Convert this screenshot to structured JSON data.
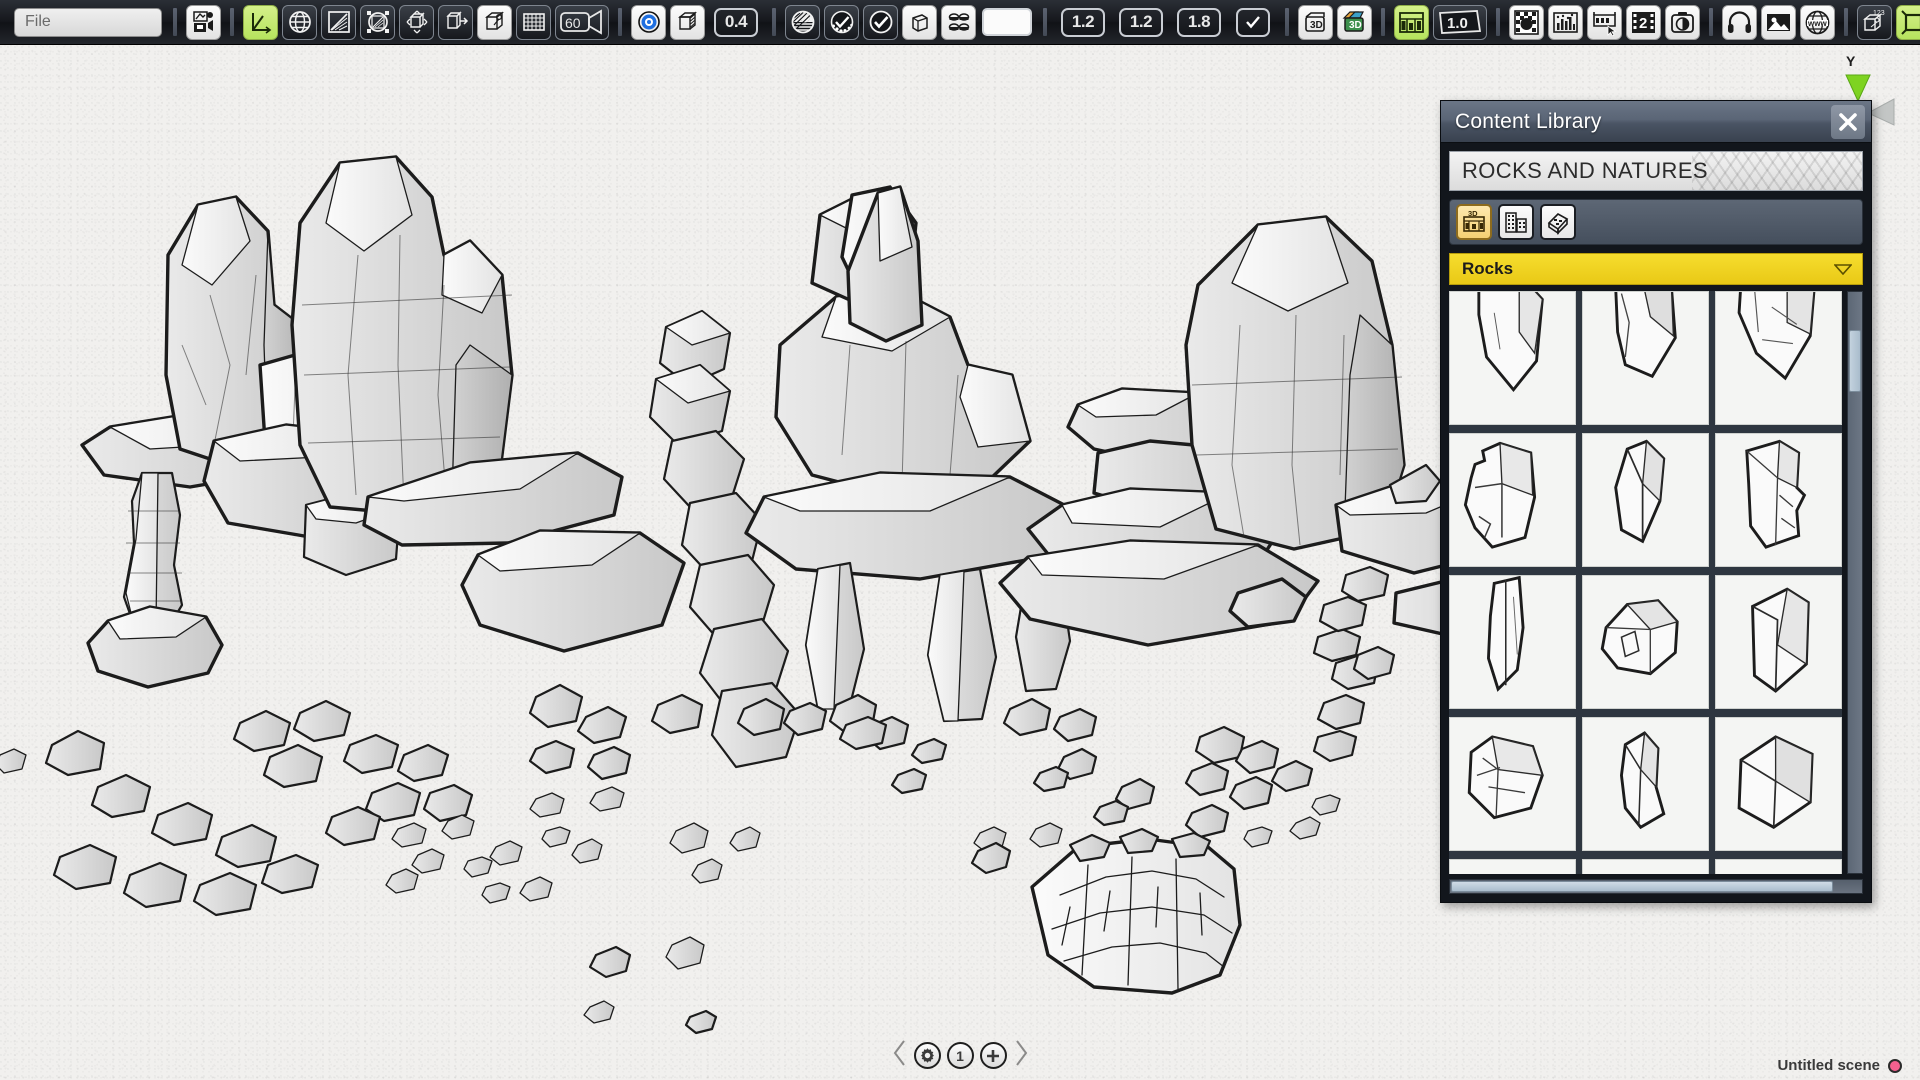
{
  "app": {
    "scene_name": "Untitled scene",
    "status_dot_color": "#f4608f"
  },
  "toolbar": {
    "file_menu_label": "File",
    "groups": [
      {
        "name": "file-group",
        "items": [
          {
            "id": "save-render-button",
            "icon": "save-render-icon",
            "style": "light",
            "label": ""
          }
        ]
      },
      {
        "name": "transform-group",
        "items": [
          {
            "id": "axis-tool-button",
            "icon": "axis-gizmo-icon",
            "style": "green",
            "label": ""
          },
          {
            "id": "globe-rotate-button",
            "icon": "globe-icon",
            "style": "dark",
            "label": ""
          },
          {
            "id": "gradient-plane-button",
            "icon": "gradient-square-icon",
            "style": "dark",
            "label": ""
          },
          {
            "id": "sphere-crop-button",
            "icon": "sphere-crop-icon",
            "style": "dark",
            "label": ""
          },
          {
            "id": "cube-rotate-button",
            "icon": "cube-rotate-icon",
            "style": "dark",
            "label": ""
          },
          {
            "id": "cube-move-button",
            "icon": "cube-move-icon",
            "style": "dark",
            "label": ""
          },
          {
            "id": "cube-point-button",
            "icon": "cube-point-icon",
            "style": "light",
            "label": ""
          },
          {
            "id": "grid-button",
            "icon": "grid-icon",
            "style": "dark",
            "label": ""
          },
          {
            "id": "camera-fov-button",
            "icon": "camera-icon",
            "style": "dark",
            "label": "60"
          }
        ]
      },
      {
        "name": "display-group",
        "items": [
          {
            "id": "target-button",
            "icon": "target-ring-icon",
            "style": "light",
            "label": ""
          },
          {
            "id": "cube-shade-button",
            "icon": "cube-hatched-icon",
            "style": "light",
            "label": ""
          },
          {
            "id": "opacity-field",
            "icon": "value-field",
            "style": "num",
            "label": "0.4"
          }
        ]
      },
      {
        "name": "shading-group",
        "items": [
          {
            "id": "shading-hatch-button",
            "icon": "sphere-hatch-icon",
            "style": "dark",
            "label": ""
          },
          {
            "id": "shading-dotted-button",
            "icon": "check-dotted-icon",
            "style": "dark",
            "label": ""
          },
          {
            "id": "shading-check-button",
            "icon": "check-circle-icon",
            "style": "dark",
            "label": ""
          },
          {
            "id": "cube-outline-button",
            "icon": "cube-outline-icon",
            "style": "light",
            "label": ""
          },
          {
            "id": "four-dots-button",
            "icon": "four-dots-icon",
            "style": "light",
            "label": ""
          },
          {
            "id": "color-swatch-button",
            "icon": "white-swatch-icon",
            "style": "swatch",
            "label": ""
          }
        ]
      },
      {
        "name": "line-group",
        "items": [
          {
            "id": "line-weight-1-field",
            "icon": "value-field",
            "style": "num",
            "label": "1.2"
          },
          {
            "id": "line-weight-2-field",
            "icon": "value-field",
            "style": "num",
            "label": "1.2"
          },
          {
            "id": "line-weight-3-field",
            "icon": "value-field",
            "style": "num",
            "label": "1.8"
          },
          {
            "id": "line-toggle-button",
            "icon": "check-icon",
            "style": "num-check",
            "label": ""
          }
        ]
      },
      {
        "name": "library-group",
        "items": [
          {
            "id": "content-3d-button",
            "icon": "folder-3d-icon",
            "style": "light",
            "label": "3D"
          },
          {
            "id": "content-3d-color-button",
            "icon": "folder-3d-color-icon",
            "style": "light",
            "label": "3D"
          }
        ]
      },
      {
        "name": "layers-group",
        "items": [
          {
            "id": "layers-button",
            "icon": "layers-icon",
            "style": "green",
            "label": ""
          },
          {
            "id": "zoom-level-button",
            "icon": "zoom-tag-icon",
            "style": "dark",
            "label": "1.0"
          }
        ]
      },
      {
        "name": "texture-group",
        "items": [
          {
            "id": "checker-button",
            "icon": "checker-sphere-icon",
            "style": "light",
            "label": ""
          },
          {
            "id": "equalizer-button",
            "icon": "equalizer-icon",
            "style": "light",
            "label": ""
          },
          {
            "id": "banner-button",
            "icon": "banner-cursor-icon",
            "style": "light",
            "label": ""
          },
          {
            "id": "film-strip-button",
            "icon": "film-2-icon",
            "style": "light",
            "label": "2"
          },
          {
            "id": "camera-capture-button",
            "icon": "camera-capture-icon",
            "style": "light",
            "label": ""
          }
        ]
      },
      {
        "name": "media-group",
        "items": [
          {
            "id": "audio-button",
            "icon": "headphones-icon",
            "style": "light",
            "label": ""
          },
          {
            "id": "image-button",
            "icon": "picture-icon",
            "style": "light",
            "label": ""
          },
          {
            "id": "web-button",
            "icon": "www-globe-icon",
            "style": "light",
            "label": ""
          }
        ]
      },
      {
        "name": "final-group",
        "items": [
          {
            "id": "cube-numbers-button",
            "icon": "cube-123-icon",
            "style": "dark",
            "label": "123"
          },
          {
            "id": "transform-handles-button",
            "icon": "transform-handles-icon",
            "style": "green",
            "label": ""
          }
        ]
      }
    ]
  },
  "viewport": {
    "gizmo": {
      "y_axis_label": "Y",
      "y_axis_color": "#7ed321",
      "x_axis_color": "#b9bcbb"
    }
  },
  "content_library": {
    "title": "Content Library",
    "close_label": "✕",
    "breadcrumb": "ROCKS AND NATURES",
    "tabs": [
      {
        "id": "tab-3d-models",
        "icon": "model-3d-icon",
        "label": "3D",
        "active": true
      },
      {
        "id": "tab-buildings",
        "icon": "buildings-icon",
        "label": "",
        "active": false
      },
      {
        "id": "tab-materials",
        "icon": "materials-icon",
        "label": "",
        "active": false
      }
    ],
    "category": {
      "name": "Rocks",
      "expanded": true,
      "chevron": "chevron-down-icon"
    },
    "thumbnails": [
      {
        "id": "rock-01",
        "shape": "wedge-tall"
      },
      {
        "id": "rock-02",
        "shape": "wedge-split"
      },
      {
        "id": "rock-03",
        "shape": "chunk-cracked"
      },
      {
        "id": "rock-04",
        "shape": "block-stepped"
      },
      {
        "id": "rock-05",
        "shape": "column-angular"
      },
      {
        "id": "rock-06",
        "shape": "pillar-square"
      },
      {
        "id": "rock-07",
        "shape": "slab-narrow"
      },
      {
        "id": "rock-08",
        "shape": "boulder-flat"
      },
      {
        "id": "rock-09",
        "shape": "pillar-tall"
      },
      {
        "id": "rock-10",
        "shape": "slab-broken"
      },
      {
        "id": "rock-11",
        "shape": "spire"
      },
      {
        "id": "rock-12",
        "shape": "cube-rough"
      },
      {
        "id": "rock-13",
        "shape": "stone-low"
      },
      {
        "id": "rock-14",
        "shape": "stone-shard"
      },
      {
        "id": "rock-15",
        "shape": "stone-flat"
      }
    ],
    "scrollbars": {
      "vertical_visible": true,
      "horizontal_visible": true
    }
  },
  "page_nav": {
    "prev_label": "◁",
    "settings_icon": "gear-icon",
    "page_number": "1",
    "add_icon": "plus-icon",
    "next_label": "▷"
  }
}
